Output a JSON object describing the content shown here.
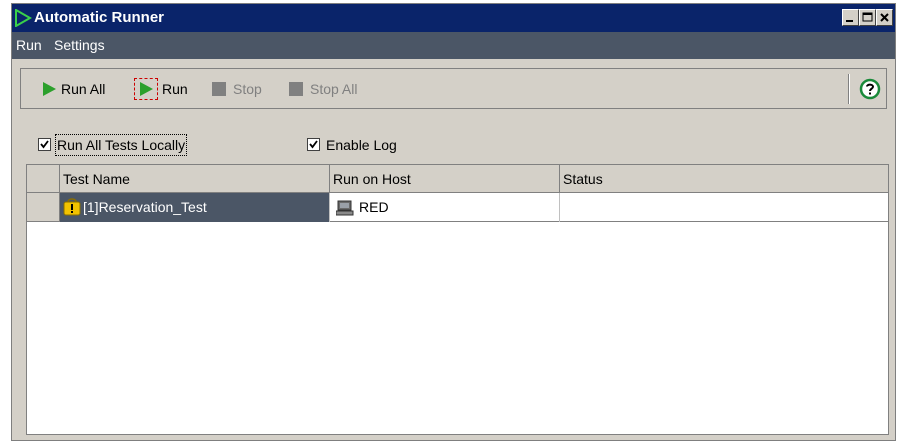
{
  "window": {
    "title": "Automatic Runner",
    "title_color": "#0a246a"
  },
  "menu": [
    "Run",
    "Settings"
  ],
  "toolbar": {
    "run_all": "Run All",
    "run": "Run",
    "stop": "Stop",
    "stop_all": "Stop All",
    "help_icon": "help-icon"
  },
  "options": {
    "run_all_locally": {
      "label": "Run All Tests Locally",
      "checked": true
    },
    "enable_log": {
      "label": "Enable Log",
      "checked": true
    }
  },
  "grid": {
    "columns": [
      "Test Name",
      "Run on Host",
      "Status"
    ],
    "rows": [
      {
        "test_name": "[1]Reservation_Test",
        "host": "RED",
        "status": ""
      }
    ]
  },
  "colors": {
    "menubar": "#4b5666",
    "selected_cell": "#4b5666",
    "play_green": "#2ca02c",
    "help_green": "#1a8a3a"
  }
}
